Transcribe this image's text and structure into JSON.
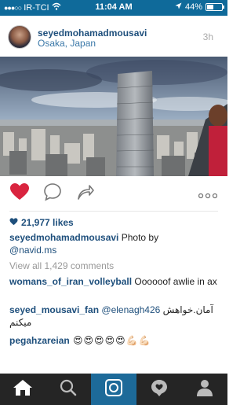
{
  "status_bar": {
    "carrier": "IR-TCI",
    "time": "11:04 AM",
    "battery_text": "44%",
    "battery_level": 0.44
  },
  "post": {
    "username": "seyedmohamadmousavi",
    "location": "Osaka, Japan",
    "time_ago": "3h",
    "likes": "21,977 likes",
    "caption_user": "seyedmohamadmousavi",
    "caption_text": " Photo by ",
    "caption_mention": "@navid.ms",
    "view_all": "View all 1,429 comments"
  },
  "comments": [
    {
      "user": "womans_of_iran_volleyball",
      "text": " Oooooof awlie in ax"
    },
    {
      "user": "seyed_mousavi_fan",
      "mention": " @elenagh426",
      "text": " آمان.خواهش میکنم"
    },
    {
      "user": "pegahzareian",
      "text": " 😍😍😍😍😍💪🏻💪🏻"
    }
  ],
  "tabs": [
    "home",
    "search",
    "camera",
    "activity",
    "profile"
  ],
  "colors": {
    "status_bg": "#0f6a9a",
    "username": "#1e4f7c",
    "heart": "#d9243f",
    "tabbar_bg": "#252525",
    "tab_active": "#1d6a99"
  }
}
